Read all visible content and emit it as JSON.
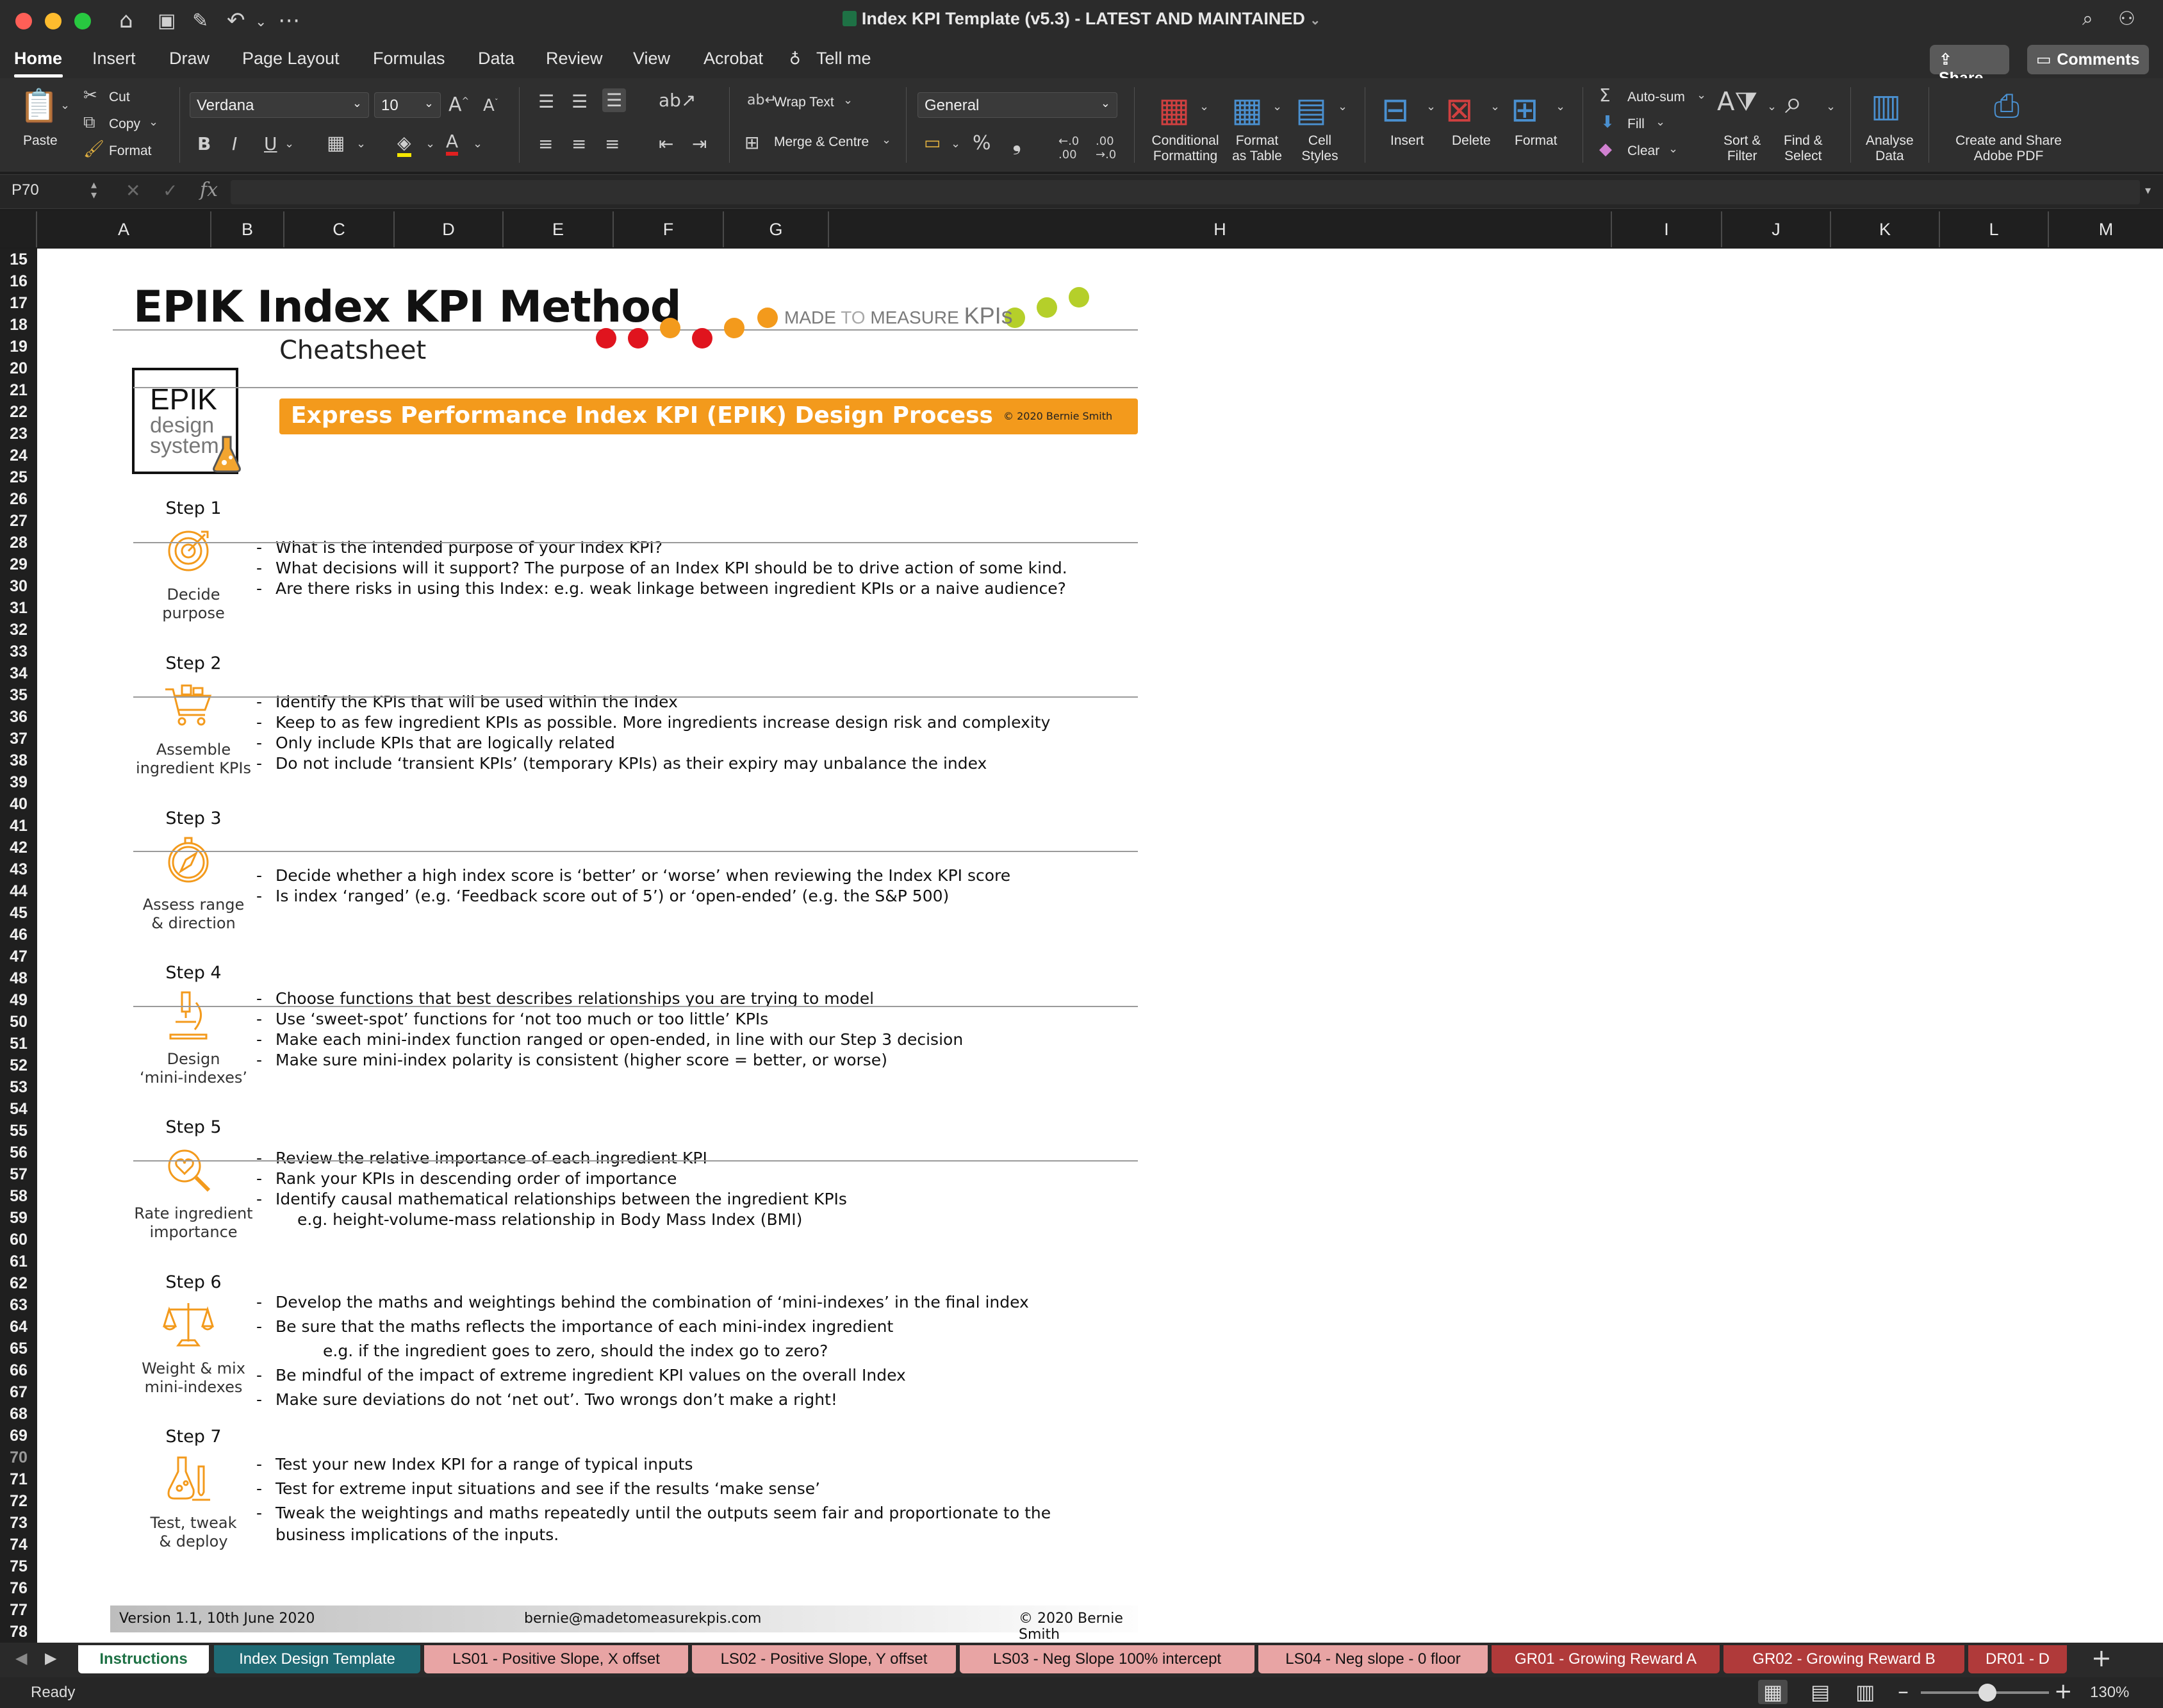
{
  "window": {
    "title": "Index KPI Template (v5.3) - LATEST AND MAINTAINED"
  },
  "ribbon_tabs": [
    "Home",
    "Insert",
    "Draw",
    "Page Layout",
    "Formulas",
    "Data",
    "Review",
    "View",
    "Acrobat",
    "Tell me"
  ],
  "top_buttons": {
    "share": "Share",
    "comments": "Comments"
  },
  "ribbon": {
    "paste": "Paste",
    "cut": "Cut",
    "copy": "Copy",
    "format": "Format",
    "font": "Verdana",
    "font_size": "10",
    "wrap_text": "Wrap Text",
    "merge_centre": "Merge & Centre",
    "number_format": "General",
    "conditional_formatting": [
      "Conditional",
      "Formatting"
    ],
    "format_as_table": [
      "Format",
      "as Table"
    ],
    "cell_styles": [
      "Cell",
      "Styles"
    ],
    "insert": "Insert",
    "delete": "Delete",
    "format_cells": "Format",
    "autosum": "Auto-sum",
    "fill": "Fill",
    "clear": "Clear",
    "sort_filter": [
      "Sort &",
      "Filter"
    ],
    "find_select": [
      "Find &",
      "Select"
    ],
    "analyse_data": [
      "Analyse",
      "Data"
    ],
    "adobe_pdf": [
      "Create and Share",
      "Adobe PDF"
    ]
  },
  "formula_bar": {
    "name_box": "P70",
    "fx": "fx"
  },
  "columns": [
    "A",
    "B",
    "C",
    "D",
    "E",
    "F",
    "G",
    "H",
    "I",
    "J",
    "K",
    "L",
    "M"
  ],
  "rows": [
    "15",
    "16",
    "17",
    "18",
    "19",
    "20",
    "21",
    "22",
    "23",
    "24",
    "25",
    "26",
    "27",
    "28",
    "29",
    "30",
    "31",
    "32",
    "33",
    "34",
    "35",
    "36",
    "37",
    "38",
    "39",
    "40",
    "41",
    "42",
    "43",
    "44",
    "45",
    "46",
    "47",
    "48",
    "49",
    "50",
    "51",
    "52",
    "53",
    "54",
    "55",
    "56",
    "57",
    "58",
    "59",
    "60",
    "61",
    "62",
    "63",
    "64",
    "65",
    "66",
    "67",
    "68",
    "69",
    "70",
    "71",
    "72",
    "73",
    "74",
    "75",
    "76",
    "77",
    "78"
  ],
  "doc": {
    "title": "EPIK Index KPI Method",
    "subtitle": "Cheatsheet",
    "brand": "MADE TO MEASURE KPIs",
    "brand_a": "MADE",
    "brand_b": "TO",
    "brand_c": "MEASURE",
    "brand_d": "KPIs",
    "logo_epik": "EPIK",
    "logo_design": "design",
    "logo_system": "system",
    "banner": "Express Performance Index KPI (EPIK) Design Process",
    "banner_copy": "© 2020 Bernie Smith",
    "steps": [
      {
        "head": "Step 1",
        "label1": "Decide",
        "label2": "purpose",
        "icon": "target-icon",
        "bullets": [
          "What is the intended purpose of your Index KPI?",
          "What decisions will it support? The purpose of an Index KPI should be to drive action of some kind.",
          "Are there risks in using this Index: e.g. weak linkage between ingredient KPIs or a naive audience?"
        ]
      },
      {
        "head": "Step 2",
        "label1": "Assemble",
        "label2": "ingredient KPIs",
        "icon": "cart-icon",
        "bullets": [
          "Identify the KPIs that will be used within the Index",
          "Keep to as few ingredient KPIs as possible. More ingredients increase design risk and complexity",
          "Only include KPIs that are logically related",
          "Do not include ‘transient KPIs’ (temporary KPIs) as their expiry may unbalance the index"
        ]
      },
      {
        "head": "Step 3",
        "label1": "Assess range",
        "label2": "& direction",
        "icon": "compass-icon",
        "bullets": [
          "Decide whether a high index score is ‘better’ or ‘worse’ when reviewing the Index KPI score",
          "Is index ‘ranged’ (e.g. ‘Feedback score out of 5’) or ‘open-ended’ (e.g. the S&P 500)"
        ]
      },
      {
        "head": "Step 4",
        "label1": "Design",
        "label2": "‘mini-indexes’",
        "icon": "microscope-icon",
        "bullets": [
          "Choose functions that best describes relationships you are trying to model",
          "Use ‘sweet-spot’ functions for ‘not too much or too little’ KPIs",
          "Make each mini-index function ranged or open-ended, in line with our Step 3 decision",
          "Make sure mini-index polarity is consistent (higher score = better, or worse)"
        ]
      },
      {
        "head": "Step 5",
        "label1": "Rate ingredient",
        "label2": "importance",
        "icon": "heart-magnifier-icon",
        "bullets": [
          "Review the relative importance of each ingredient KPI",
          "Rank your KPIs in descending order of importance",
          "Identify causal mathematical relationships between the ingredient KPIs"
        ],
        "sub": "e.g. height-volume-mass relationship in Body Mass Index (BMI)"
      },
      {
        "head": "Step 6",
        "label1": "Weight & mix",
        "label2": "mini-indexes",
        "icon": "scales-icon",
        "bullets": [
          "Develop the maths and weightings behind the combination of ‘mini-indexes’ in the final index",
          "Be sure that the maths reflects the importance of each mini-index ingredient",
          "Be mindful of the impact of extreme ingredient KPI values on the overall Index",
          "Make sure deviations do not ‘net out’. Two wrongs don’t make a right!"
        ],
        "sub": "e.g. if the ingredient goes to zero, should the index go to zero?"
      },
      {
        "head": "Step 7",
        "label1": "Test, tweak",
        "label2": "& deploy",
        "icon": "flask-icon",
        "bullets": [
          "Test your new Index KPI for a range of typical inputs",
          "Test for extreme input situations and see if the results ‘make sense’",
          "Tweak the weightings and maths repeatedly until the outputs seem fair and proportionate to the"
        ],
        "sub": "business implications of the inputs."
      }
    ],
    "footer": {
      "version": "Version 1.1,  10th June 2020",
      "email": "bernie@madetomeasurekpis.com",
      "copyright": "© 2020 Bernie Smith"
    }
  },
  "sheet_tabs": [
    {
      "label": "Instructions",
      "color": "#ffffff"
    },
    {
      "label": "Index Design Template",
      "color": "#1f6b75"
    },
    {
      "label": "LS01 - Positive Slope, X offset",
      "color": "#e8a4a4"
    },
    {
      "label": "LS02 - Positive Slope, Y offset",
      "color": "#e8a4a4"
    },
    {
      "label": "LS03 - Neg Slope 100% intercept",
      "color": "#e8a4a4"
    },
    {
      "label": "LS04 - Neg slope - 0 floor",
      "color": "#e8a4a4"
    },
    {
      "label": "GR01 - Growing Reward A",
      "color": "#b03a3a"
    },
    {
      "label": "GR02 - Growing Reward B",
      "color": "#b03a3a"
    },
    {
      "label": "DR01 - D",
      "color": "#b03a3a"
    }
  ],
  "status": {
    "ready": "Ready",
    "zoom": "130%"
  },
  "colors": {
    "orange": "#f39a1c",
    "red": "#e0141e",
    "green": "#b5cf2a"
  }
}
